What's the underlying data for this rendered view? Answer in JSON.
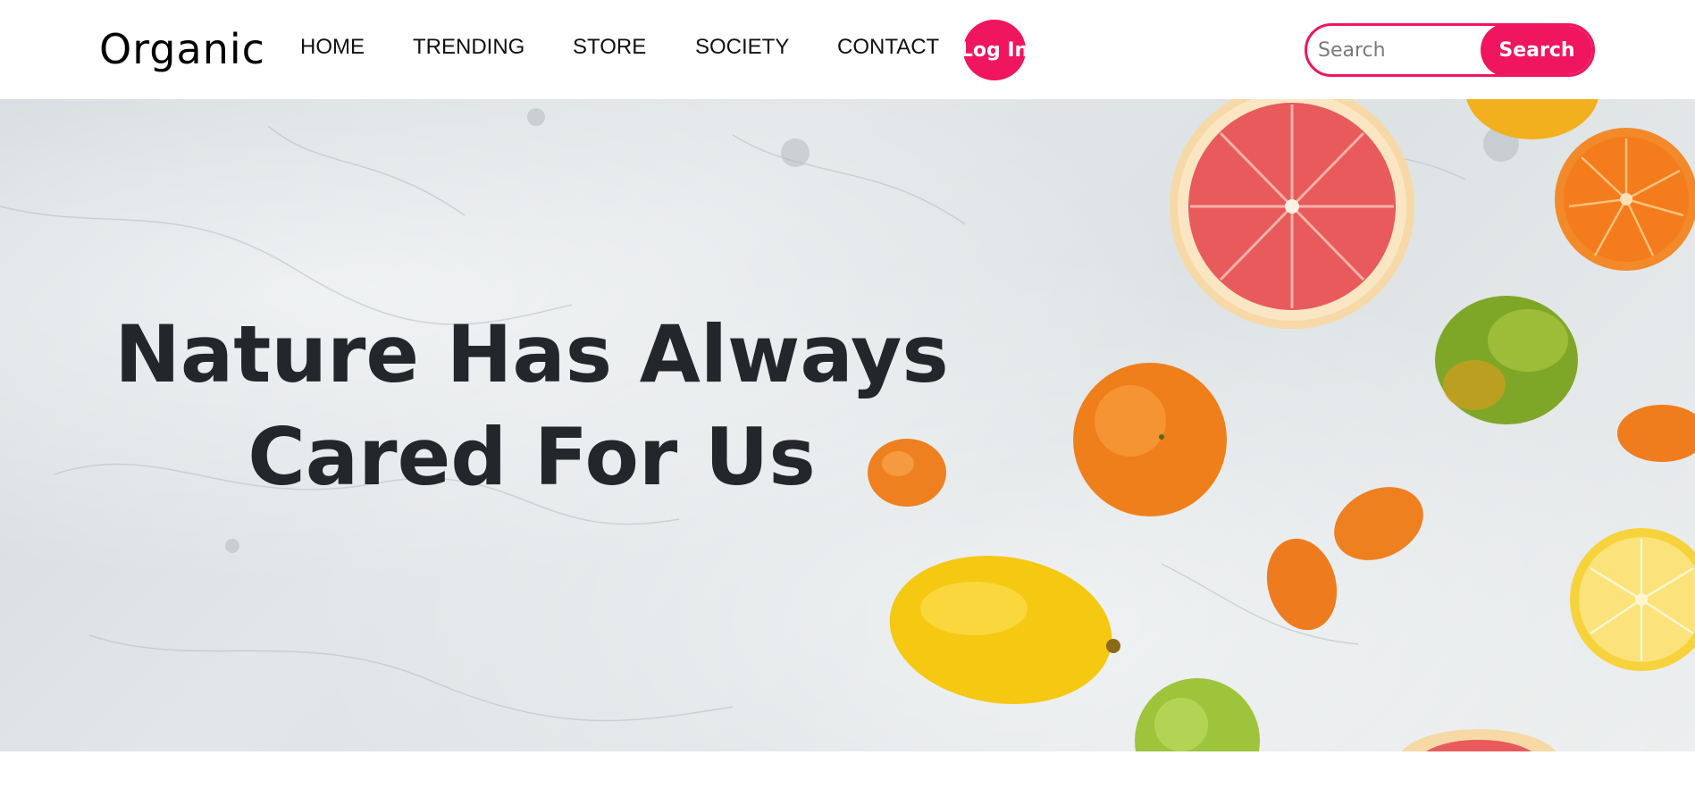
{
  "navbar": {
    "brand": "Organic",
    "links": [
      "HOME",
      "TRENDING",
      "STORE",
      "SOCIETY",
      "CONTACT"
    ],
    "login_label": "Log In",
    "search": {
      "placeholder": "Search",
      "value": "",
      "button_label": "Search"
    }
  },
  "hero": {
    "title_line1": "Nature Has Always",
    "title_line2": "Cared For Us",
    "image_description_icon": "citrus-fruits-on-marble-image"
  },
  "colors": {
    "accent": "#f0155f",
    "hero_text": "#23272b",
    "nav_text": "#111111",
    "background": "#ffffff"
  }
}
